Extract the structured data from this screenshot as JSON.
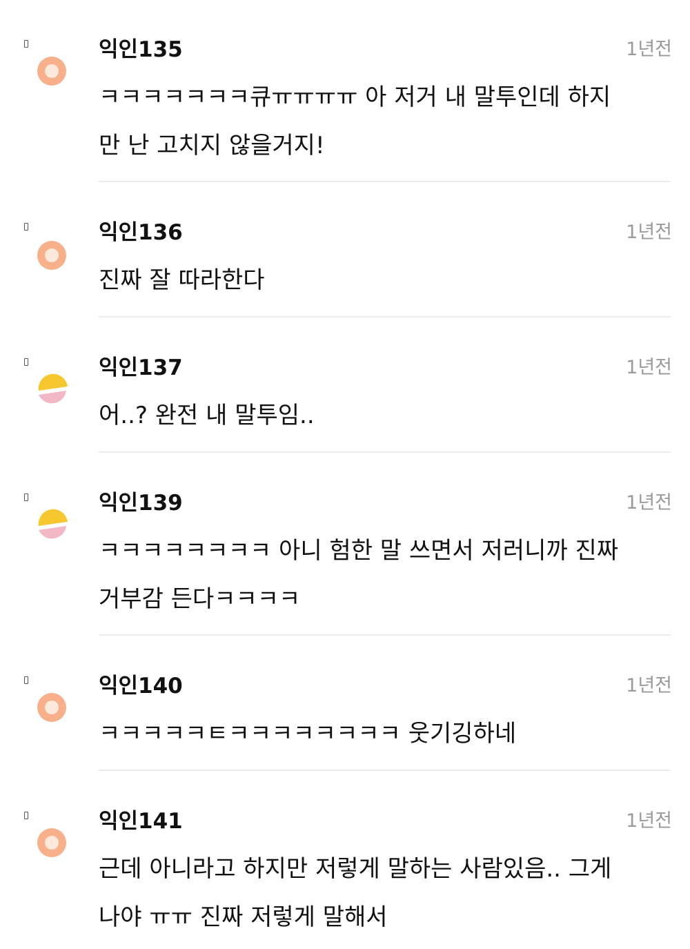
{
  "colors": {
    "peach_avatar_outer": "#f7b08a",
    "peach_avatar_inner": "#fde8dc",
    "yellow_avatar": "#f6c72e",
    "pink_avatar": "#f2b8c6",
    "time_text": "#9a9a9a",
    "divider": "#ececec"
  },
  "comments": [
    {
      "nickname": "익인135",
      "time": "1년전",
      "text": "ㅋㅋㅋㅋㅋㅋㅋ큐ㅠㅠㅠㅠ 아 저거 내 말투인데 하지\n만 난 고치지 않을거지!",
      "avatar": "peach-ring-icon"
    },
    {
      "nickname": "익인136",
      "time": "1년전",
      "text": "진짜 잘 따라한다",
      "avatar": "peach-ring-icon"
    },
    {
      "nickname": "익인137",
      "time": "1년전",
      "text": "어..? 완전 내 말투임..",
      "avatar": "split-circle-icon"
    },
    {
      "nickname": "익인139",
      "time": "1년전",
      "text": "ㅋㅋㅋㅋㅋㅋㅋㅋ 아니 험한 말 쓰면서 저러니까 진짜\n거부감 든다ㅋㅋㅋㅋ",
      "avatar": "split-circle-icon"
    },
    {
      "nickname": "익인140",
      "time": "1년전",
      "text": "ㅋㅋㅋㅋㅋㅌㅋㅋㅋㅋㅋㅋㅋㅋ 웃기깅하네",
      "avatar": "peach-ring-icon"
    },
    {
      "nickname": "익인141",
      "time": "1년전",
      "text": "근데 아니라고 하지만 저렇게 말하는 사람있음.. 그게\n나야 ㅠㅠ 진짜 저렇게 말해서",
      "avatar": "peach-ring-icon"
    }
  ]
}
